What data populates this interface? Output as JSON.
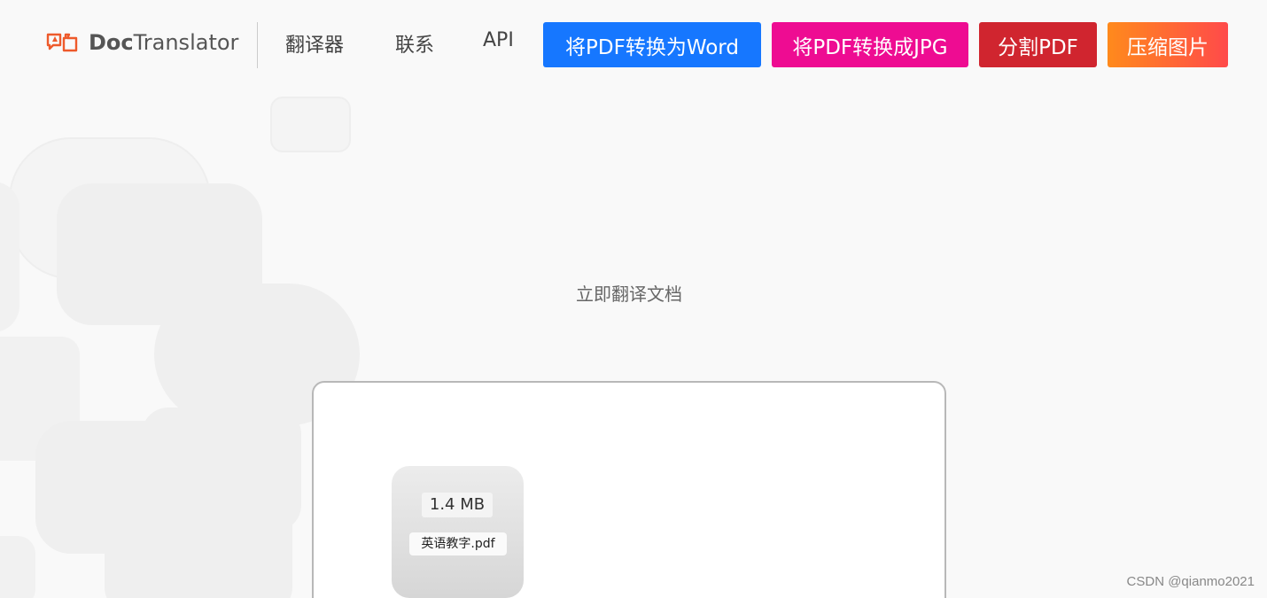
{
  "header": {
    "logo_bold": "Doc",
    "logo_rest": "Translator",
    "nav": {
      "translator": "翻译器",
      "contact": "联系",
      "api": "API"
    },
    "buttons": {
      "pdf_to_word": "将PDF转换为Word",
      "pdf_to_jpg": "将PDF转换成JPG",
      "split_pdf": "分割PDF",
      "compress_image": "压缩图片"
    }
  },
  "colors": {
    "accent_logo": "#ee5a2b",
    "pdf_to_word": "#1677ff",
    "pdf_to_jpg": "#ee0c92",
    "split_pdf": "#d0252f",
    "compress_image_from": "#ff8a1c",
    "compress_image_to": "#ff4a4a"
  },
  "main": {
    "tagline": "立即翻译文档"
  },
  "file": {
    "size": "1.4 MB",
    "name": "英语教字.pdf"
  },
  "watermark": "CSDN @qianmo2021"
}
